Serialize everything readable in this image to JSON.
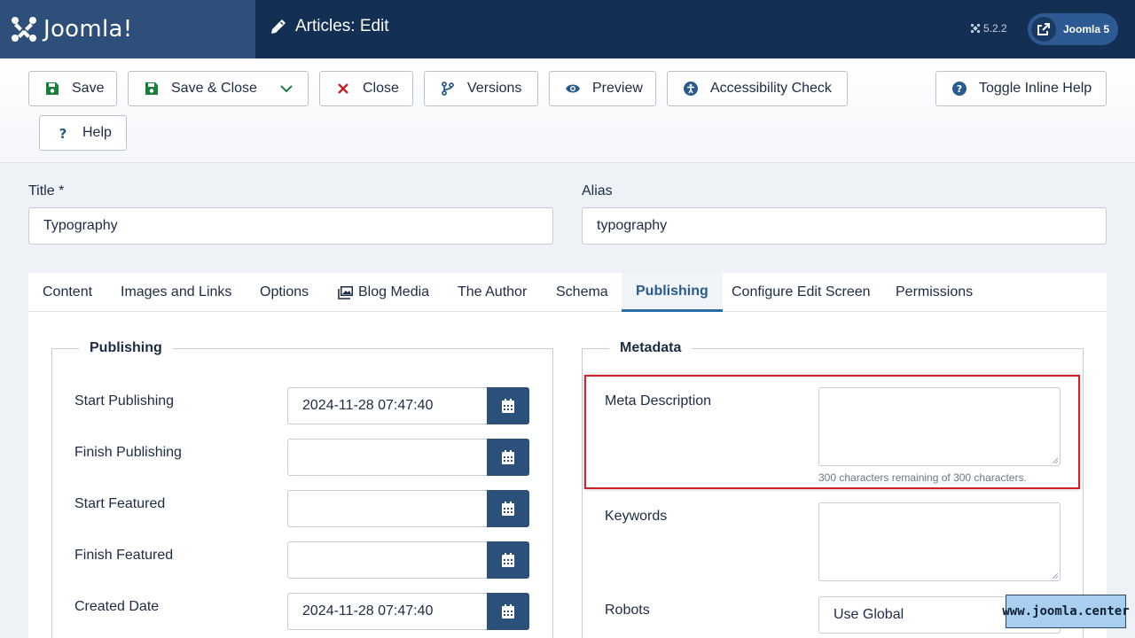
{
  "header": {
    "brand": "Joomla!",
    "page_title": "Articles: Edit",
    "version": "5.2.2",
    "site_button": "Joomla 5"
  },
  "toolbar": {
    "save": "Save",
    "save_close": "Save & Close",
    "close": "Close",
    "versions": "Versions",
    "preview": "Preview",
    "accessibility": "Accessibility Check",
    "toggle_help": "Toggle Inline Help",
    "help": "Help"
  },
  "fields": {
    "title_label": "Title *",
    "title_value": "Typography",
    "alias_label": "Alias",
    "alias_value": "typography"
  },
  "tabs": [
    "Content",
    "Images and Links",
    "Options",
    "Blog Media",
    "The Author",
    "Schema",
    "Publishing",
    "Configure Edit Screen",
    "Permissions"
  ],
  "active_tab": "Publishing",
  "publishing": {
    "legend": "Publishing",
    "start_publishing_label": "Start Publishing",
    "start_publishing_value": "2024-11-28 07:47:40",
    "finish_publishing_label": "Finish Publishing",
    "start_featured_label": "Start Featured",
    "finish_featured_label": "Finish Featured",
    "created_date_label": "Created Date",
    "created_date_value": "2024-11-28 07:47:40"
  },
  "metadata": {
    "legend": "Metadata",
    "meta_description_label": "Meta Description",
    "meta_description_hint": "300 characters remaining of 300 characters.",
    "keywords_label": "Keywords",
    "robots_label": "Robots",
    "robots_value": "Use Global"
  },
  "watermark": "www.joomla.center",
  "colors": {
    "header_bg": "#132f53",
    "brand_bg": "#2d4f7a",
    "accent": "#2b5079",
    "highlight": "#d4202a"
  }
}
